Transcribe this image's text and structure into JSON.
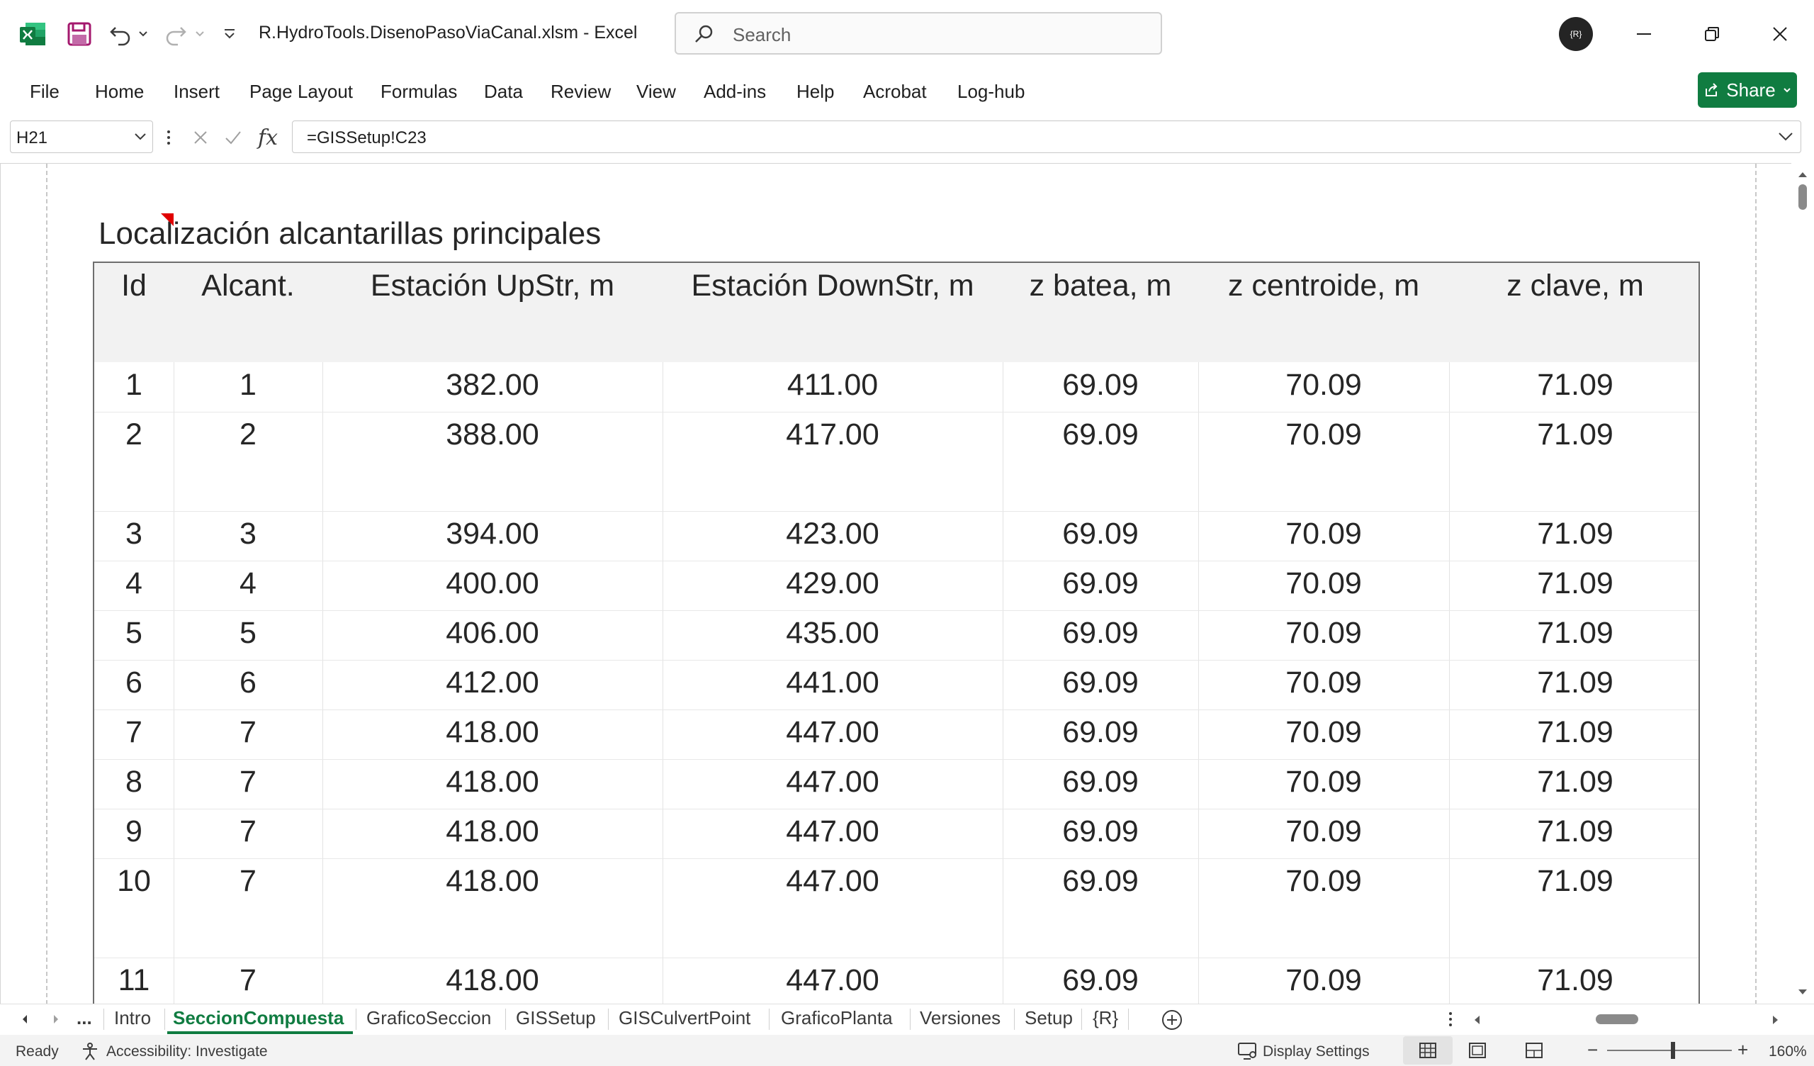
{
  "window": {
    "file_title": "R.HydroTools.DisenoPasoViaCanal.xlsm  -  Excel",
    "search_placeholder": "Search",
    "avatar_label": "{R}"
  },
  "menu": {
    "items": [
      "File",
      "Home",
      "Insert",
      "Page Layout",
      "Formulas",
      "Data",
      "Review",
      "View",
      "Add-ins",
      "Help",
      "Acrobat",
      "Log-hub"
    ],
    "share_label": "Share"
  },
  "formula_bar": {
    "name_box": "H21",
    "formula": "=GISSetup!C23",
    "fx": "fx"
  },
  "sheet": {
    "title": "Localización alcantarillas principales",
    "headers": [
      "Id",
      "Alcant.",
      "Estación UpStr, m",
      "Estación DownStr, m",
      "z batea, m",
      "z centroide, m",
      "z clave, m"
    ],
    "rows": [
      [
        "1",
        "1",
        "382.00",
        "411.00",
        "69.09",
        "70.09",
        "71.09"
      ],
      [
        "2",
        "2",
        "388.00",
        "417.00",
        "69.09",
        "70.09",
        "71.09"
      ],
      [
        "3",
        "3",
        "394.00",
        "423.00",
        "69.09",
        "70.09",
        "71.09"
      ],
      [
        "4",
        "4",
        "400.00",
        "429.00",
        "69.09",
        "70.09",
        "71.09"
      ],
      [
        "5",
        "5",
        "406.00",
        "435.00",
        "69.09",
        "70.09",
        "71.09"
      ],
      [
        "6",
        "6",
        "412.00",
        "441.00",
        "69.09",
        "70.09",
        "71.09"
      ],
      [
        "7",
        "7",
        "418.00",
        "447.00",
        "69.09",
        "70.09",
        "71.09"
      ],
      [
        "8",
        "7",
        "418.00",
        "447.00",
        "69.09",
        "70.09",
        "71.09"
      ],
      [
        "9",
        "7",
        "418.00",
        "447.00",
        "69.09",
        "70.09",
        "71.09"
      ],
      [
        "10",
        "7",
        "418.00",
        "447.00",
        "69.09",
        "70.09",
        "71.09"
      ],
      [
        "11",
        "7",
        "418.00",
        "447.00",
        "69.09",
        "70.09",
        "71.09"
      ]
    ]
  },
  "tabs": {
    "ellipsis": "...",
    "items": [
      "Intro",
      "SeccionCompuesta",
      "GraficoSeccion",
      "GISSetup",
      "GISCulvertPoint",
      "GraficoPlanta",
      "Versiones",
      "Setup",
      "{R}"
    ],
    "active": "SeccionCompuesta"
  },
  "status": {
    "ready": "Ready",
    "accessibility": "Accessibility: Investigate",
    "display_settings": "Display Settings",
    "zoom": "160%",
    "minus": "−",
    "plus": "+"
  },
  "colors": {
    "excel_green": "#107c41",
    "comment_red": "#e00000"
  }
}
